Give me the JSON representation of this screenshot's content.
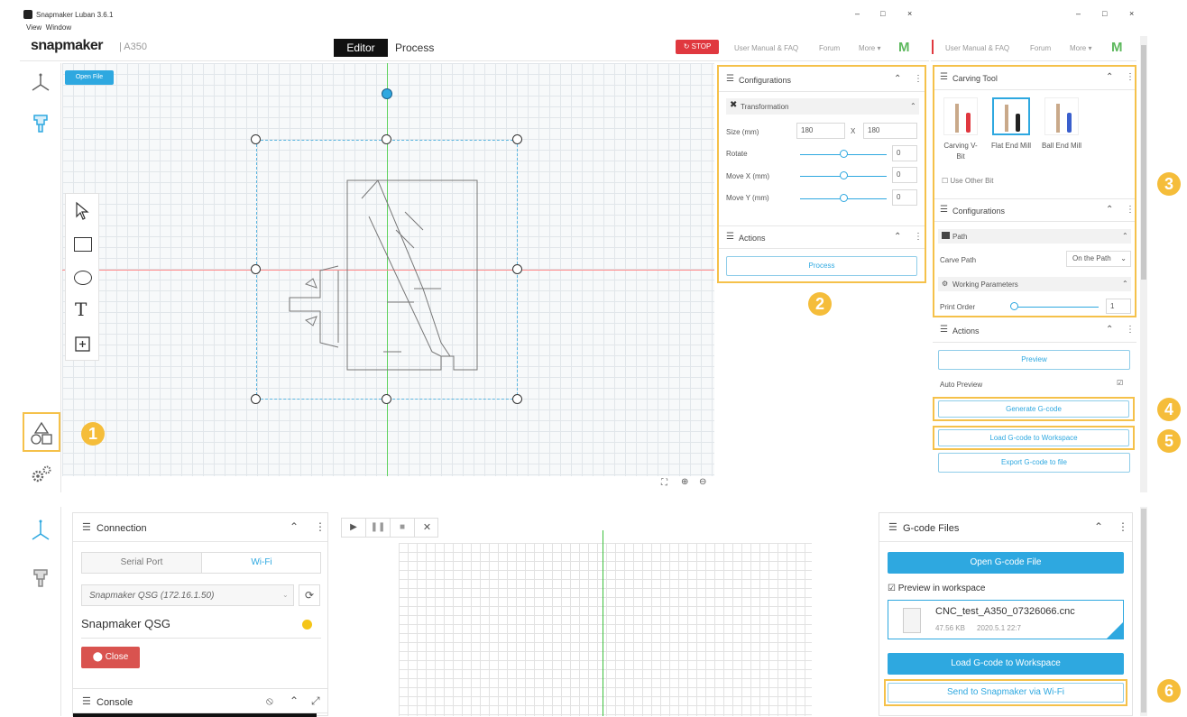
{
  "window": {
    "title": "Snapmaker Luban 3.6.1",
    "menu": [
      "View",
      "Window"
    ],
    "controls": [
      "–",
      "□",
      "×"
    ]
  },
  "header": {
    "logo": "snapmaker",
    "machine": "| A350",
    "tabs": [
      "Editor",
      "Process"
    ],
    "stop_label": "STOP",
    "links": [
      "User Manual & FAQ",
      "Forum",
      "More ▾"
    ],
    "m_logo": "M"
  },
  "canvas": {
    "open_file_label": "Open File"
  },
  "config_panel": {
    "title": "Configurations",
    "transformation_label": "Transformation",
    "size_label": "Size (mm)",
    "size_w": "180",
    "size_x": "X",
    "size_h": "180",
    "rotate_label": "Rotate",
    "rotate_value": "0",
    "movex_label": "Move X (mm)",
    "movex_value": "0",
    "movey_label": "Move Y (mm)",
    "movey_value": "0",
    "actions_title": "Actions",
    "process_label": "Process"
  },
  "right_panel": {
    "carving_title": "Carving Tool",
    "tools": [
      "Carving V-Bit",
      "Flat End Mill",
      "Ball End Mill"
    ],
    "use_other_bit": "Use Other Bit",
    "config_title": "Configurations",
    "path_label": "Path",
    "carve_path_label": "Carve Path",
    "carve_path_value": "On the Path",
    "working_params": "Working Parameters",
    "print_order_label": "Print Order",
    "print_order_value": "1",
    "actions_title": "Actions",
    "preview_label": "Preview",
    "auto_preview": "Auto Preview",
    "generate_label": "Generate G-code",
    "load_label": "Load G-code to Workspace",
    "export_label": "Export G-code to file"
  },
  "badges": [
    "1",
    "2",
    "3",
    "4",
    "5",
    "6"
  ],
  "connection": {
    "title": "Connection",
    "tabs": [
      "Serial Port",
      "Wi-Fi"
    ],
    "device": "Snapmaker QSG (172.16.1.50)",
    "name": "Snapmaker QSG",
    "close_label": "Close",
    "console_title": "Console"
  },
  "gcode": {
    "title": "G-code Files",
    "open_label": "Open G-code File",
    "preview_ws": "Preview in workspace",
    "file_name": "CNC_test_A350_07326066.cnc",
    "file_size": "47.56 KB",
    "file_date": "2020.5.1 22:7",
    "load_label": "Load G-code to Workspace",
    "send_label": "Send to Snapmaker via Wi-Fi"
  },
  "colors": {
    "accent": "#2ea8e0",
    "highlight": "#f5c14a",
    "stop": "#e0383f",
    "close": "#d9534f"
  }
}
